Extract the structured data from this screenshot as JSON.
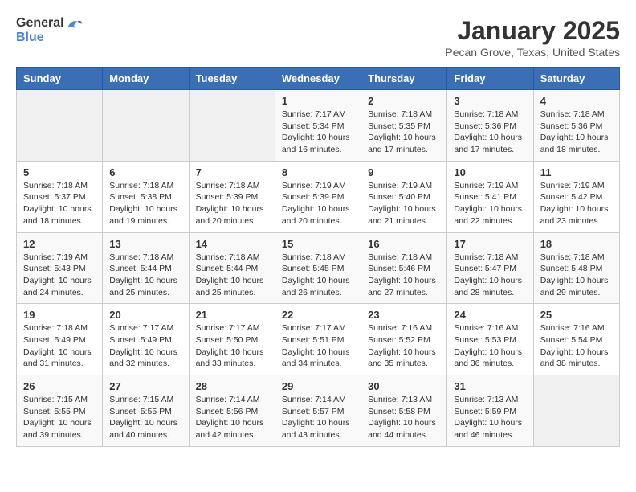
{
  "header": {
    "logo_general": "General",
    "logo_blue": "Blue",
    "month_year": "January 2025",
    "location": "Pecan Grove, Texas, United States"
  },
  "days_of_week": [
    "Sunday",
    "Monday",
    "Tuesday",
    "Wednesday",
    "Thursday",
    "Friday",
    "Saturday"
  ],
  "weeks": [
    [
      {
        "day": "",
        "info": ""
      },
      {
        "day": "",
        "info": ""
      },
      {
        "day": "",
        "info": ""
      },
      {
        "day": "1",
        "info": "Sunrise: 7:17 AM\nSunset: 5:34 PM\nDaylight: 10 hours\nand 16 minutes."
      },
      {
        "day": "2",
        "info": "Sunrise: 7:18 AM\nSunset: 5:35 PM\nDaylight: 10 hours\nand 17 minutes."
      },
      {
        "day": "3",
        "info": "Sunrise: 7:18 AM\nSunset: 5:36 PM\nDaylight: 10 hours\nand 17 minutes."
      },
      {
        "day": "4",
        "info": "Sunrise: 7:18 AM\nSunset: 5:36 PM\nDaylight: 10 hours\nand 18 minutes."
      }
    ],
    [
      {
        "day": "5",
        "info": "Sunrise: 7:18 AM\nSunset: 5:37 PM\nDaylight: 10 hours\nand 18 minutes."
      },
      {
        "day": "6",
        "info": "Sunrise: 7:18 AM\nSunset: 5:38 PM\nDaylight: 10 hours\nand 19 minutes."
      },
      {
        "day": "7",
        "info": "Sunrise: 7:18 AM\nSunset: 5:39 PM\nDaylight: 10 hours\nand 20 minutes."
      },
      {
        "day": "8",
        "info": "Sunrise: 7:19 AM\nSunset: 5:39 PM\nDaylight: 10 hours\nand 20 minutes."
      },
      {
        "day": "9",
        "info": "Sunrise: 7:19 AM\nSunset: 5:40 PM\nDaylight: 10 hours\nand 21 minutes."
      },
      {
        "day": "10",
        "info": "Sunrise: 7:19 AM\nSunset: 5:41 PM\nDaylight: 10 hours\nand 22 minutes."
      },
      {
        "day": "11",
        "info": "Sunrise: 7:19 AM\nSunset: 5:42 PM\nDaylight: 10 hours\nand 23 minutes."
      }
    ],
    [
      {
        "day": "12",
        "info": "Sunrise: 7:19 AM\nSunset: 5:43 PM\nDaylight: 10 hours\nand 24 minutes."
      },
      {
        "day": "13",
        "info": "Sunrise: 7:18 AM\nSunset: 5:44 PM\nDaylight: 10 hours\nand 25 minutes."
      },
      {
        "day": "14",
        "info": "Sunrise: 7:18 AM\nSunset: 5:44 PM\nDaylight: 10 hours\nand 25 minutes."
      },
      {
        "day": "15",
        "info": "Sunrise: 7:18 AM\nSunset: 5:45 PM\nDaylight: 10 hours\nand 26 minutes."
      },
      {
        "day": "16",
        "info": "Sunrise: 7:18 AM\nSunset: 5:46 PM\nDaylight: 10 hours\nand 27 minutes."
      },
      {
        "day": "17",
        "info": "Sunrise: 7:18 AM\nSunset: 5:47 PM\nDaylight: 10 hours\nand 28 minutes."
      },
      {
        "day": "18",
        "info": "Sunrise: 7:18 AM\nSunset: 5:48 PM\nDaylight: 10 hours\nand 29 minutes."
      }
    ],
    [
      {
        "day": "19",
        "info": "Sunrise: 7:18 AM\nSunset: 5:49 PM\nDaylight: 10 hours\nand 31 minutes."
      },
      {
        "day": "20",
        "info": "Sunrise: 7:17 AM\nSunset: 5:49 PM\nDaylight: 10 hours\nand 32 minutes."
      },
      {
        "day": "21",
        "info": "Sunrise: 7:17 AM\nSunset: 5:50 PM\nDaylight: 10 hours\nand 33 minutes."
      },
      {
        "day": "22",
        "info": "Sunrise: 7:17 AM\nSunset: 5:51 PM\nDaylight: 10 hours\nand 34 minutes."
      },
      {
        "day": "23",
        "info": "Sunrise: 7:16 AM\nSunset: 5:52 PM\nDaylight: 10 hours\nand 35 minutes."
      },
      {
        "day": "24",
        "info": "Sunrise: 7:16 AM\nSunset: 5:53 PM\nDaylight: 10 hours\nand 36 minutes."
      },
      {
        "day": "25",
        "info": "Sunrise: 7:16 AM\nSunset: 5:54 PM\nDaylight: 10 hours\nand 38 minutes."
      }
    ],
    [
      {
        "day": "26",
        "info": "Sunrise: 7:15 AM\nSunset: 5:55 PM\nDaylight: 10 hours\nand 39 minutes."
      },
      {
        "day": "27",
        "info": "Sunrise: 7:15 AM\nSunset: 5:55 PM\nDaylight: 10 hours\nand 40 minutes."
      },
      {
        "day": "28",
        "info": "Sunrise: 7:14 AM\nSunset: 5:56 PM\nDaylight: 10 hours\nand 42 minutes."
      },
      {
        "day": "29",
        "info": "Sunrise: 7:14 AM\nSunset: 5:57 PM\nDaylight: 10 hours\nand 43 minutes."
      },
      {
        "day": "30",
        "info": "Sunrise: 7:13 AM\nSunset: 5:58 PM\nDaylight: 10 hours\nand 44 minutes."
      },
      {
        "day": "31",
        "info": "Sunrise: 7:13 AM\nSunset: 5:59 PM\nDaylight: 10 hours\nand 46 minutes."
      },
      {
        "day": "",
        "info": ""
      }
    ]
  ]
}
